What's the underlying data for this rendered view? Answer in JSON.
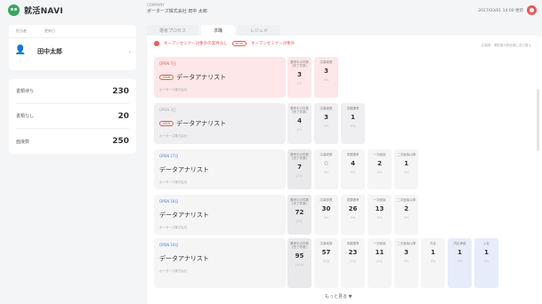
{
  "app": {
    "logo": "就活NAVI"
  },
  "header": {
    "company_small": "COMPANY",
    "company_name": "ポーターズ株式会社 田中 太郎",
    "datetime": "2017/03/01 14:00 更新"
  },
  "sidebar": {
    "user_card": {
      "col1": "担当者",
      "col2": "更新日",
      "name": "田中太郎"
    },
    "stats": [
      {
        "label": "書類待ち",
        "value": "230"
      },
      {
        "label": "書類なし",
        "value": "20"
      },
      {
        "label": "面接数",
        "value": "250"
      }
    ]
  },
  "tabs": [
    "選考プロセス",
    "求職",
    "レジュメ"
  ],
  "filters": {
    "alert": "オープンセミナー対象外の案件なし",
    "pill1": "NEW",
    "text2": "オープンセミナー対象外",
    "right_text": "応募数・閲覧数の割合順に並び替え"
  },
  "job_cards": [
    {
      "date": "OPEN 7日",
      "pill": "NEW",
      "title": "データアナリスト",
      "company": "ポーターズ株式会社",
      "cells": [
        {
          "head": "選考中の件数\n(完了件数)",
          "value": "3",
          "sub": "(0)"
        },
        {
          "head": "応募総数",
          "value": "3",
          "sub": "0%"
        }
      ]
    },
    {
      "date": "OPEN 3日",
      "pill": "NEW",
      "title": "データアナリスト",
      "company": "ポーターズ株式会社",
      "cells": [
        {
          "head": "選考中の件数\n(完了件数)",
          "value": "4",
          "sub": "(0)"
        },
        {
          "head": "応募総数",
          "value": "3",
          "sub": "0%"
        },
        {
          "head": "書類選考",
          "value": "1",
          "sub": "0%"
        }
      ]
    },
    {
      "date": "OPEN 17日",
      "pill": "",
      "title": "データアナリスト",
      "company": "ポーターズ株式会社",
      "cells": [
        {
          "head": "選考中の件数\n(完了件数)",
          "value": "7",
          "sub": "(15)"
        },
        {
          "head": "応募総数",
          "value": "0",
          "sub": "0%"
        },
        {
          "head": "書類選考",
          "value": "4",
          "sub": "0%"
        },
        {
          "head": "一次面接",
          "value": "2",
          "sub": "0%"
        },
        {
          "head": "二次面接以降",
          "value": "1",
          "sub": "0%"
        }
      ]
    },
    {
      "date": "OPEN 18日",
      "pill": "",
      "title": "データアナリスト",
      "company": "ポーターズ株式会社",
      "cells": [
        {
          "head": "選考中の件数\n(完了件数)",
          "value": "72",
          "sub": "(30)"
        },
        {
          "head": "応募総数",
          "value": "30",
          "sub": "0%"
        },
        {
          "head": "書類選考",
          "value": "26",
          "sub": "0%"
        },
        {
          "head": "一次面接",
          "value": "13",
          "sub": "0%"
        },
        {
          "head": "二次面接以降",
          "value": "2",
          "sub": "0%"
        }
      ]
    },
    {
      "date": "OPEN 19日",
      "pill": "",
      "title": "データアナリスト",
      "company": "ポーターズ株式会社",
      "cells": [
        {
          "head": "選考中の件数\n(完了件数)",
          "value": "95",
          "sub": "(100)"
        },
        {
          "head": "応募総数",
          "value": "57",
          "sub": "(50)"
        },
        {
          "head": "書類選考",
          "value": "23",
          "sub": "(70)"
        },
        {
          "head": "一次面接",
          "value": "11",
          "sub": "(22)"
        },
        {
          "head": "二次面接以降",
          "value": "3",
          "sub": "0%"
        },
        {
          "head": "内定",
          "value": "1",
          "sub": "0%"
        },
        {
          "head": "内定承諾",
          "value": "1",
          "sub": "0%"
        },
        {
          "head": "入社",
          "value": "1",
          "sub": "0%"
        }
      ]
    }
  ],
  "more_label": "もっと見る ▼"
}
